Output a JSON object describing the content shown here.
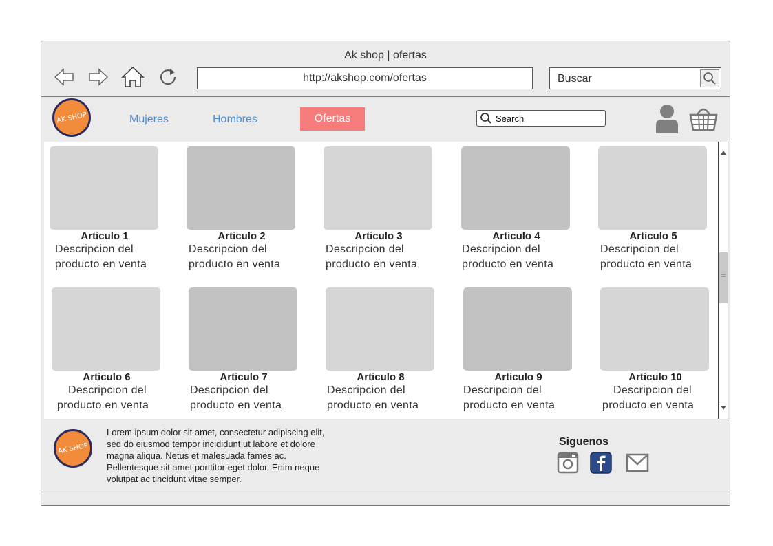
{
  "window": {
    "title": "Ak shop | ofertas"
  },
  "browser": {
    "url": "http://akshop.com/ofertas",
    "search_label": "Buscar",
    "nav_icons": [
      "back-arrow-icon",
      "forward-arrow-icon",
      "home-icon",
      "reload-icon"
    ]
  },
  "header": {
    "logo_text": "AK SHOP",
    "nav": [
      "Mujeres",
      "Hombres",
      "Ofertas"
    ],
    "active_nav": "Ofertas",
    "search_placeholder": "Search",
    "icons": [
      "user-icon",
      "basket-icon"
    ],
    "colors": {
      "link": "#4a90d9",
      "active_bg": "#f67c7c",
      "logo_orange": "#f28b3a",
      "logo_ring": "#2e2a5e"
    }
  },
  "products": [
    {
      "name": "Articulo 1",
      "desc1": "Descripcion del",
      "desc2": "producto en venta"
    },
    {
      "name": "Articulo 2",
      "desc1": "Descripcion del",
      "desc2": "producto en venta"
    },
    {
      "name": "Articulo 3",
      "desc1": "Descripcion del",
      "desc2": "producto en venta"
    },
    {
      "name": "Articulo 4",
      "desc1": "Descripcion del",
      "desc2": "producto en venta"
    },
    {
      "name": "Articulo 5",
      "desc1": "Descripcion del",
      "desc2": "producto en venta"
    },
    {
      "name": "Articulo 6",
      "desc1": "Descripcion del",
      "desc2": "producto en venta"
    },
    {
      "name": "Articulo 7",
      "desc1": "Descripcion del",
      "desc2": "producto en venta"
    },
    {
      "name": "Articulo 8",
      "desc1": "Descripcion del",
      "desc2": "producto en venta"
    },
    {
      "name": "Articulo 9",
      "desc1": "Descripcion del",
      "desc2": "producto en venta"
    },
    {
      "name": "Articulo 10",
      "desc1": "Descripcion del",
      "desc2": "producto en venta"
    }
  ],
  "footer": {
    "lines": [
      "Lorem ipsum dolor sit amet, consectetur adipiscing elit,",
      "sed do eiusmod tempor incididunt ut labore et dolore",
      "magna aliqua. Netus et malesuada fames ac.",
      "Pellentesque sit amet porttitor eget dolor. Enim neque",
      "volutpat ac tincidunt vitae semper."
    ],
    "follow_label": "Siguenos",
    "social_icons": [
      "instagram-icon",
      "facebook-icon",
      "mail-icon"
    ]
  }
}
